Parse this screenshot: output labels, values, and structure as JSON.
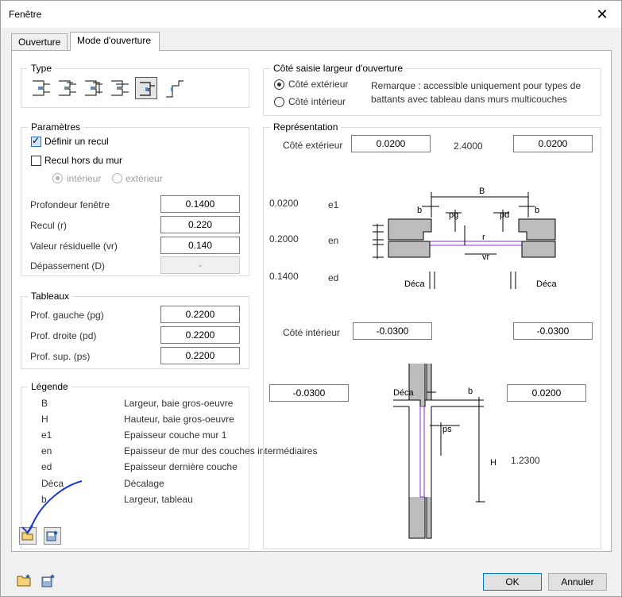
{
  "window": {
    "title": "Fenêtre"
  },
  "tabs": [
    {
      "label": "Ouverture",
      "active": false
    },
    {
      "label": "Mode d'ouverture",
      "active": true
    }
  ],
  "type_group": {
    "title": "Type",
    "selected_index": 4
  },
  "side_group": {
    "title": "Côté saisie largeur d'ouverture",
    "options": [
      {
        "label": "Côté extérieur",
        "checked": true
      },
      {
        "label": "Côté intérieur",
        "checked": false
      }
    ],
    "remark_line1": "Remarque : accessible uniquement pour types de",
    "remark_line2": "battants avec tableau dans murs multicouches"
  },
  "params": {
    "title": "Paramètres",
    "define_recess": {
      "label": "Définir un recul",
      "checked": true
    },
    "recess_outside": {
      "label": "Recul hors du mur",
      "checked": false
    },
    "sub_interior": "intérieur",
    "sub_exterior": "extérieur",
    "rows": [
      {
        "label": "Profondeur fenêtre",
        "value": "0.1400"
      },
      {
        "label": "Recul (r)",
        "value": "0.220"
      },
      {
        "label": "Valeur résiduelle (vr)",
        "value": "0.140"
      },
      {
        "label": "Dépassement (D)",
        "value": "-"
      }
    ]
  },
  "tableaux": {
    "title": "Tableaux",
    "rows": [
      {
        "label": "Prof. gauche  (pg)",
        "value": "0.2200"
      },
      {
        "label": "Prof. droite  (pd)",
        "value": "0.2200"
      },
      {
        "label": "Prof. sup.  (ps)",
        "value": "0.2200"
      }
    ]
  },
  "legend": {
    "title": "Légende",
    "rows": [
      {
        "key": "B",
        "value": "Largeur, baie gros-oeuvre"
      },
      {
        "key": "H",
        "value": "Hauteur, baie gros-oeuvre"
      },
      {
        "key": "e1",
        "value": "Epaisseur couche mur 1"
      },
      {
        "key": "en",
        "value": "Epaisseur de mur des couches intermédiaires"
      },
      {
        "key": "ed",
        "value": "Epaisseur dernière couche"
      },
      {
        "key": "Déca",
        "value": "Décalage"
      },
      {
        "key": "b",
        "value": "Largeur, tableau"
      }
    ]
  },
  "representation": {
    "title": "Représentation",
    "ext_label": "Côté extérieur",
    "ext_left": "0.0200",
    "ext_mid": "2.4000",
    "ext_right": "0.0200",
    "e1_value": "0.0200",
    "e1_label": "e1",
    "en_value": "0.2000",
    "en_label": "en",
    "ed_value": "0.1400",
    "ed_label": "ed",
    "int_label": "Côté intérieur",
    "int_left": "-0.0300",
    "int_right": "-0.0300",
    "side_left": "-0.0300",
    "side_right": "0.0200",
    "h_value": "1.2300",
    "plan_labels": {
      "B": "B",
      "b_left": "b",
      "b_right": "b",
      "pg": "pg",
      "pd": "pd",
      "r": "r",
      "vr": "vr",
      "deca_left": "Déca",
      "deca_right": "Déca"
    },
    "section_labels": {
      "deca": "Déca",
      "b": "b",
      "ps": "ps",
      "H": "H"
    }
  },
  "footer": {
    "ok": "OK",
    "cancel": "Annuler"
  }
}
